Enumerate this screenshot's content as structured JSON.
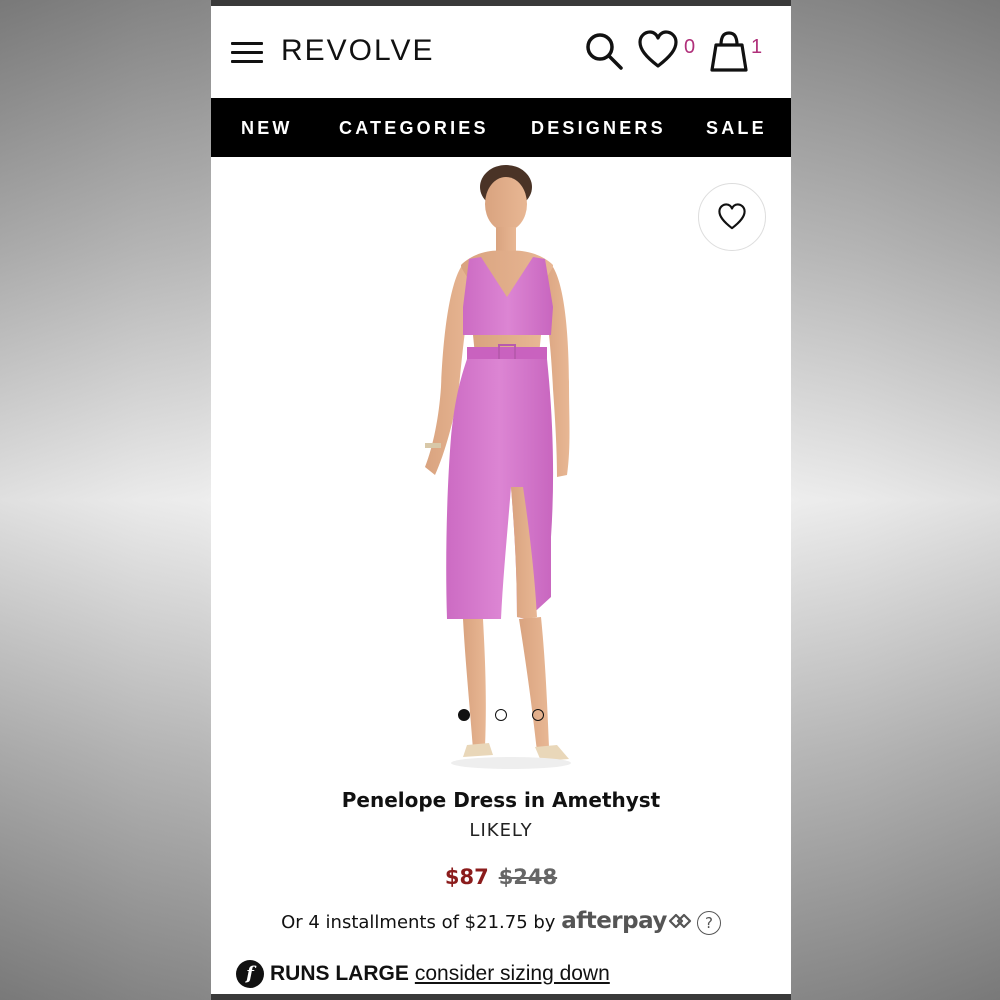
{
  "header": {
    "logo": "REVOLVE",
    "wishlist_count": "0",
    "bag_count": "1"
  },
  "nav": {
    "items": [
      "NEW",
      "CATEGORIES",
      "DESIGNERS",
      "SALE"
    ]
  },
  "product": {
    "title": "Penelope Dress in Amethyst",
    "brand": "LIKELY",
    "sale_price": "$87",
    "original_price": "$248",
    "installments_text": "Or 4 installments of $21.75 by",
    "afterpay_label": "afterpay",
    "help_symbol": "?",
    "fit_icon_letter": "f",
    "fit_label": "RUNS LARGE",
    "fit_link": "consider sizing down",
    "image_dots_total": 3,
    "image_dots_active": 1,
    "dress_color": "#d97bd0"
  },
  "colors": {
    "sale_price": "#8b1c1c",
    "count_accent": "#b0307a",
    "nav_background": "#000000"
  }
}
